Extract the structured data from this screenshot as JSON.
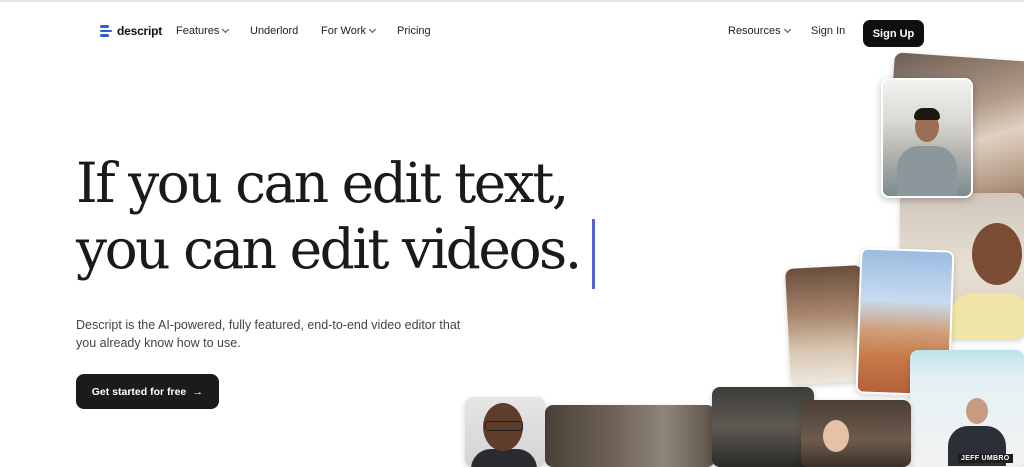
{
  "nav": {
    "logo_text": "descript",
    "items": [
      {
        "label": "Features",
        "dropdown": true
      },
      {
        "label": "Underlord",
        "dropdown": false
      },
      {
        "label": "For Work",
        "dropdown": true
      },
      {
        "label": "Pricing",
        "dropdown": false
      }
    ],
    "resources_label": "Resources",
    "signin_label": "Sign In",
    "signup_label": "Sign Up"
  },
  "hero": {
    "headline_line1": "If you can edit text,",
    "headline_line2": "you can edit videos.",
    "subcopy": "Descript is the AI-powered, fully featured, end-to-end video editor that you already know how to use.",
    "cta_label": "Get started for free",
    "cta_icon": "arrow-right-icon"
  },
  "collage": {
    "name_tag": "JEFF UMBRO"
  },
  "colors": {
    "brand_blue": "#2f5bd6",
    "caret": "#5563d6",
    "button_dark": "#0f0f0f"
  }
}
